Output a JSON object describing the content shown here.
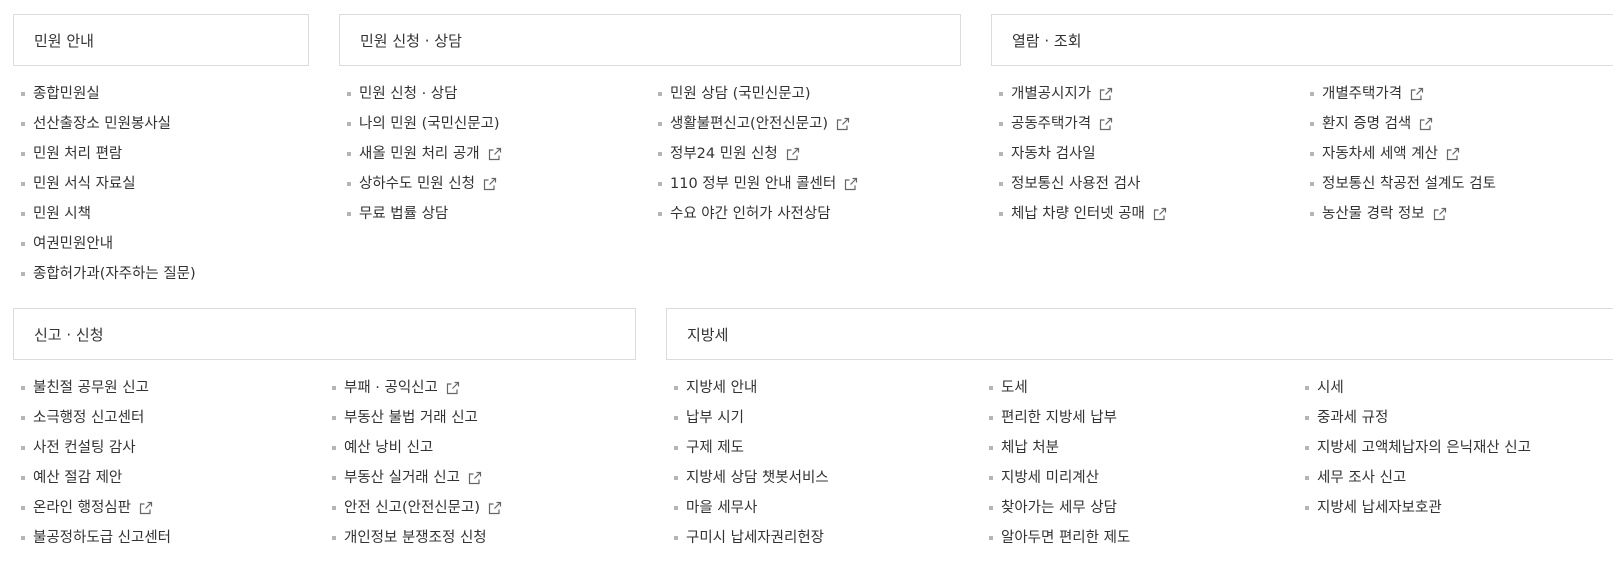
{
  "sections": {
    "guide": {
      "title": "민원 안내",
      "cols": [
        [
          {
            "label": "종합민원실",
            "ext": false
          },
          {
            "label": "선산출장소 민원봉사실",
            "ext": false
          },
          {
            "label": "민원 처리 편람",
            "ext": false
          },
          {
            "label": "민원 서식 자료실",
            "ext": false
          },
          {
            "label": "민원 시책",
            "ext": false
          },
          {
            "label": "여권민원안내",
            "ext": false
          },
          {
            "label": "종합허가과(자주하는 질문)",
            "ext": false
          }
        ]
      ]
    },
    "apply": {
      "title": "민원 신청 · 상담",
      "cols": [
        [
          {
            "label": "민원 신청 · 상담",
            "ext": false
          },
          {
            "label": "나의 민원 (국민신문고)",
            "ext": false
          },
          {
            "label": "새올 민원 처리 공개",
            "ext": true
          },
          {
            "label": "상하수도 민원 신청",
            "ext": true
          },
          {
            "label": "무료 법률 상담",
            "ext": false
          }
        ],
        [
          {
            "label": "민원 상담 (국민신문고)",
            "ext": false
          },
          {
            "label": "생활불편신고(안전신문고)",
            "ext": true
          },
          {
            "label": "정부24 민원 신청",
            "ext": true
          },
          {
            "label": "110 정부 민원 안내 콜센터",
            "ext": true
          },
          {
            "label": "수요 야간 인허가 사전상담",
            "ext": false
          }
        ]
      ]
    },
    "view": {
      "title": "열람 · 조회",
      "cols": [
        [
          {
            "label": "개별공시지가",
            "ext": true
          },
          {
            "label": "공동주택가격",
            "ext": true
          },
          {
            "label": "자동차 검사일",
            "ext": false
          },
          {
            "label": "정보통신 사용전 검사",
            "ext": false
          },
          {
            "label": "체납 차량 인터넷 공매",
            "ext": true
          }
        ],
        [
          {
            "label": "개별주택가격",
            "ext": true
          },
          {
            "label": "환지 증명 검색",
            "ext": true
          },
          {
            "label": "자동차세 세액 계산",
            "ext": true
          },
          {
            "label": "정보통신 착공전 설계도 검토",
            "ext": false
          },
          {
            "label": "농산물 경락 정보",
            "ext": true
          }
        ]
      ]
    },
    "report": {
      "title": "신고 · 신청",
      "cols": [
        [
          {
            "label": "불친절 공무원 신고",
            "ext": false
          },
          {
            "label": "소극행정 신고센터",
            "ext": false
          },
          {
            "label": "사전 컨설팅 감사",
            "ext": false
          },
          {
            "label": "예산 절감 제안",
            "ext": false
          },
          {
            "label": "온라인 행정심판",
            "ext": true
          },
          {
            "label": "불공정하도급 신고센터",
            "ext": false
          }
        ],
        [
          {
            "label": "부패 · 공익신고",
            "ext": true
          },
          {
            "label": "부동산 불법 거래 신고",
            "ext": false
          },
          {
            "label": "예산 낭비 신고",
            "ext": false
          },
          {
            "label": "부동산 실거래 신고",
            "ext": true
          },
          {
            "label": "안전 신고(안전신문고)",
            "ext": true
          },
          {
            "label": "개인정보 분쟁조정 신청",
            "ext": false
          }
        ]
      ]
    },
    "tax": {
      "title": "지방세",
      "cols": [
        [
          {
            "label": "지방세 안내",
            "ext": false
          },
          {
            "label": "납부 시기",
            "ext": false
          },
          {
            "label": "구제 제도",
            "ext": false
          },
          {
            "label": "지방세 상담 챗봇서비스",
            "ext": false
          },
          {
            "label": "마을 세무사",
            "ext": false
          },
          {
            "label": "구미시 납세자권리헌장",
            "ext": false
          }
        ],
        [
          {
            "label": "도세",
            "ext": false
          },
          {
            "label": "편리한 지방세 납부",
            "ext": false
          },
          {
            "label": "체납 처분",
            "ext": false
          },
          {
            "label": "지방세 미리계산",
            "ext": false
          },
          {
            "label": "찾아가는 세무 상담",
            "ext": false
          },
          {
            "label": "알아두면 편리한 제도",
            "ext": false
          }
        ],
        [
          {
            "label": "시세",
            "ext": false
          },
          {
            "label": "중과세 규정",
            "ext": false
          },
          {
            "label": "지방세 고액체납자의 은닉재산 신고",
            "ext": false
          },
          {
            "label": "세무 조사 신고",
            "ext": false
          },
          {
            "label": "지방세 납세자보호관",
            "ext": false
          }
        ]
      ]
    }
  }
}
